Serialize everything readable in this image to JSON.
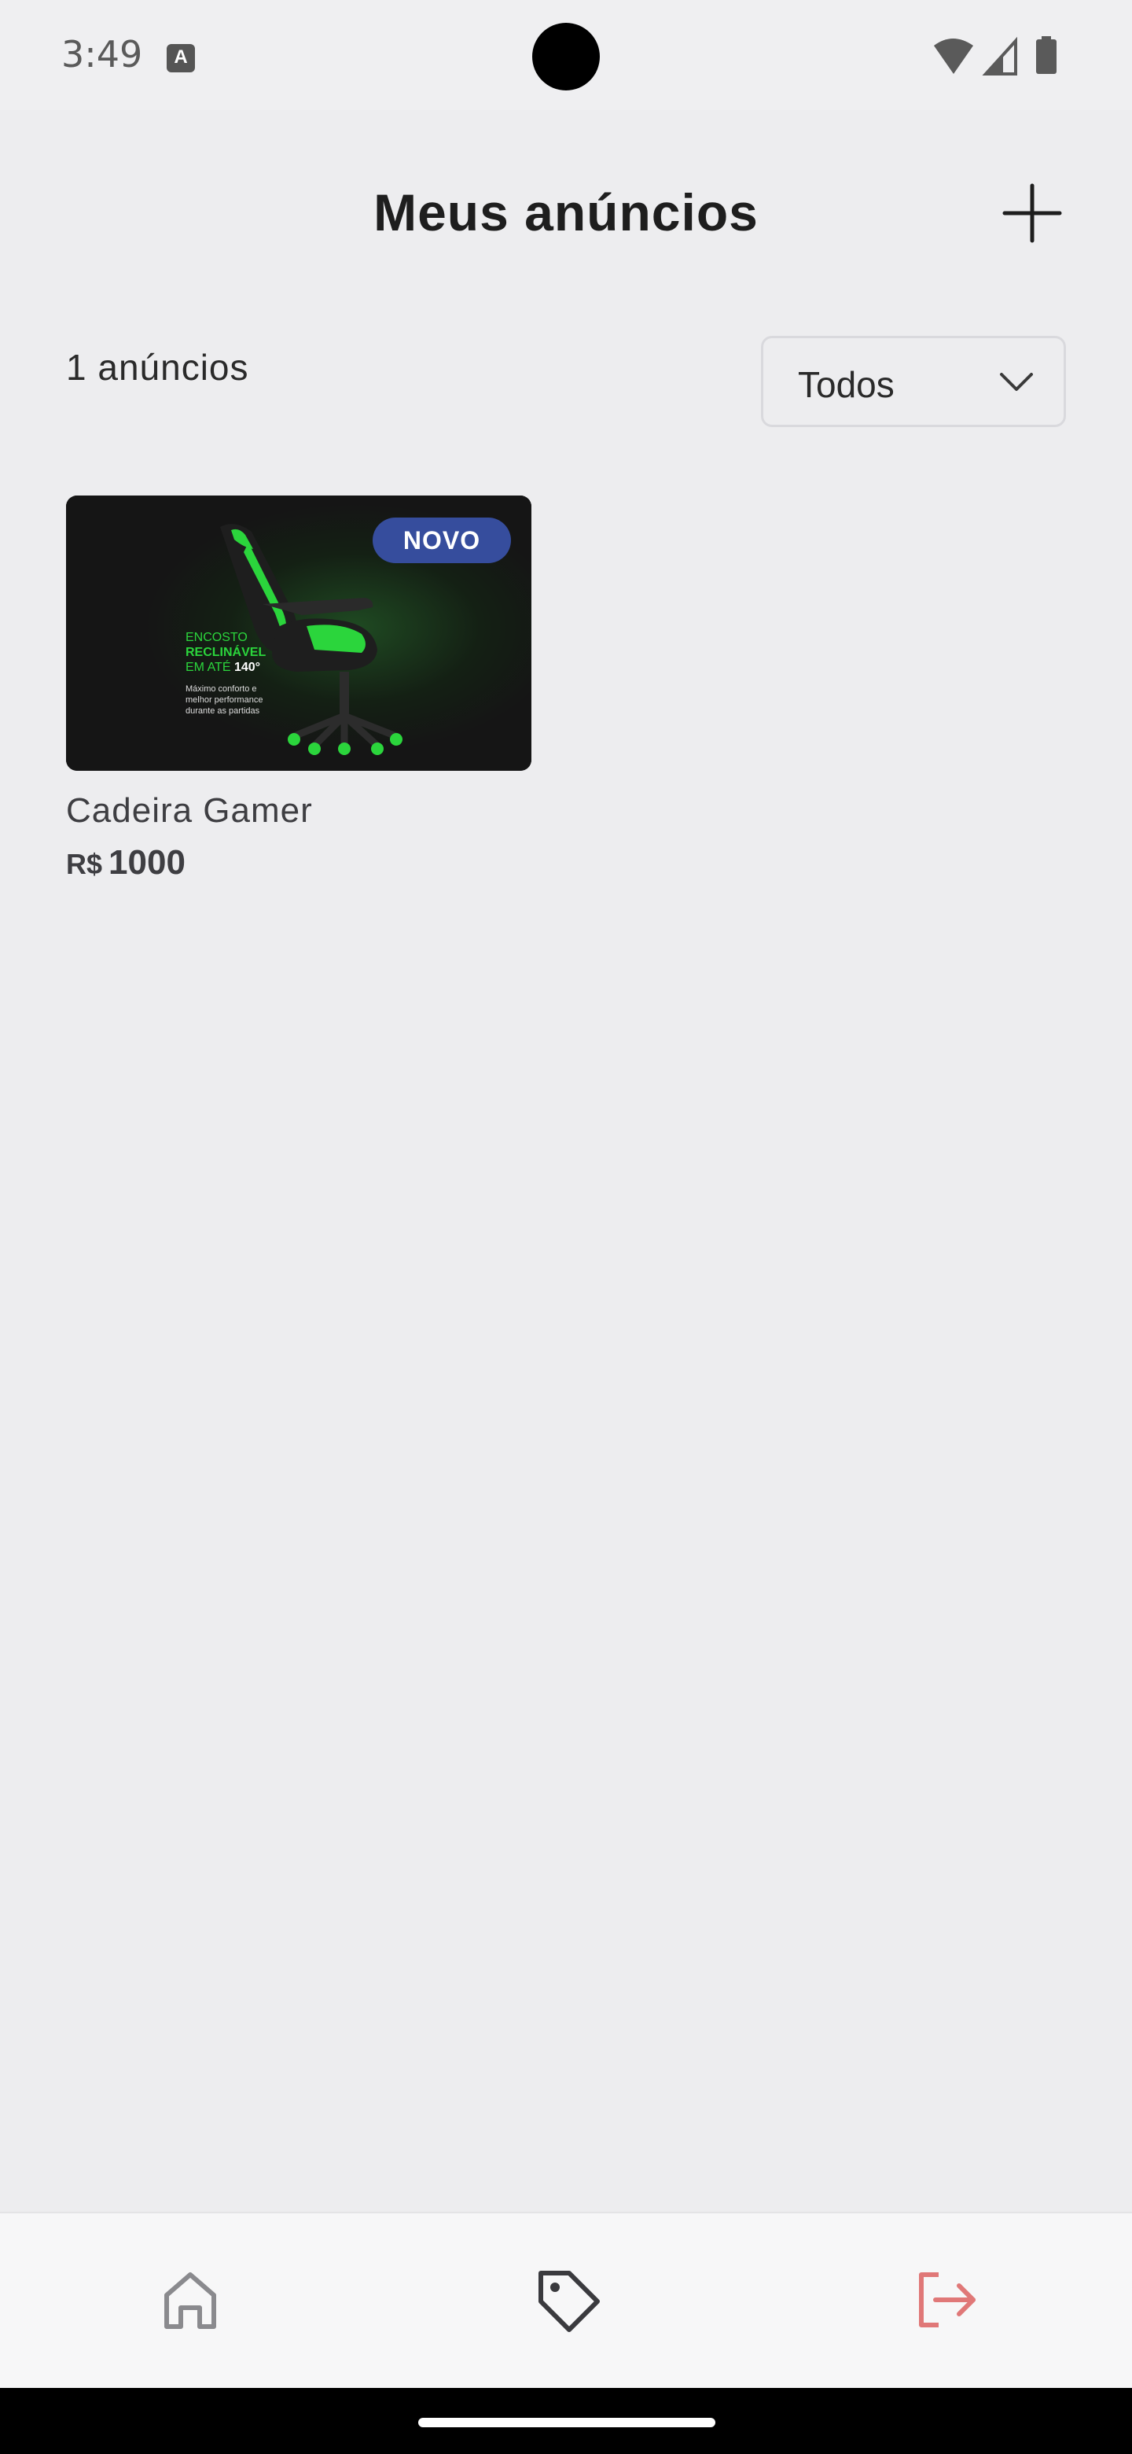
{
  "status_bar": {
    "time": "3:49",
    "notification_icon": "a-icon",
    "indicators": [
      "wifi-icon",
      "signal-icon",
      "battery-icon"
    ]
  },
  "header": {
    "title": "Meus anúncios",
    "add_icon": "plus-icon"
  },
  "toolbar": {
    "count_label": "1 anúncios",
    "filter": {
      "selected": "Todos",
      "icon": "chevron-down-icon"
    }
  },
  "listings": [
    {
      "name": "Cadeira Gamer",
      "currency": "R$",
      "price": "1000",
      "badge": "NOVO",
      "image_text": {
        "line1": "ENCOSTO",
        "line2": "RECLINÁVEL",
        "line3a": "EM ATÉ ",
        "line3b": "140°",
        "small1": "Máximo conforto e",
        "small2": "melhor performance",
        "small3": "durante as partidas"
      }
    }
  ],
  "bottom_nav": {
    "items": [
      "home-icon",
      "tag-icon",
      "sign-out-icon"
    ]
  },
  "colors": {
    "background": "#EDEDEF",
    "badge": "#364D9D",
    "logout": "#E07878",
    "chair_green": "#2BD53C"
  }
}
